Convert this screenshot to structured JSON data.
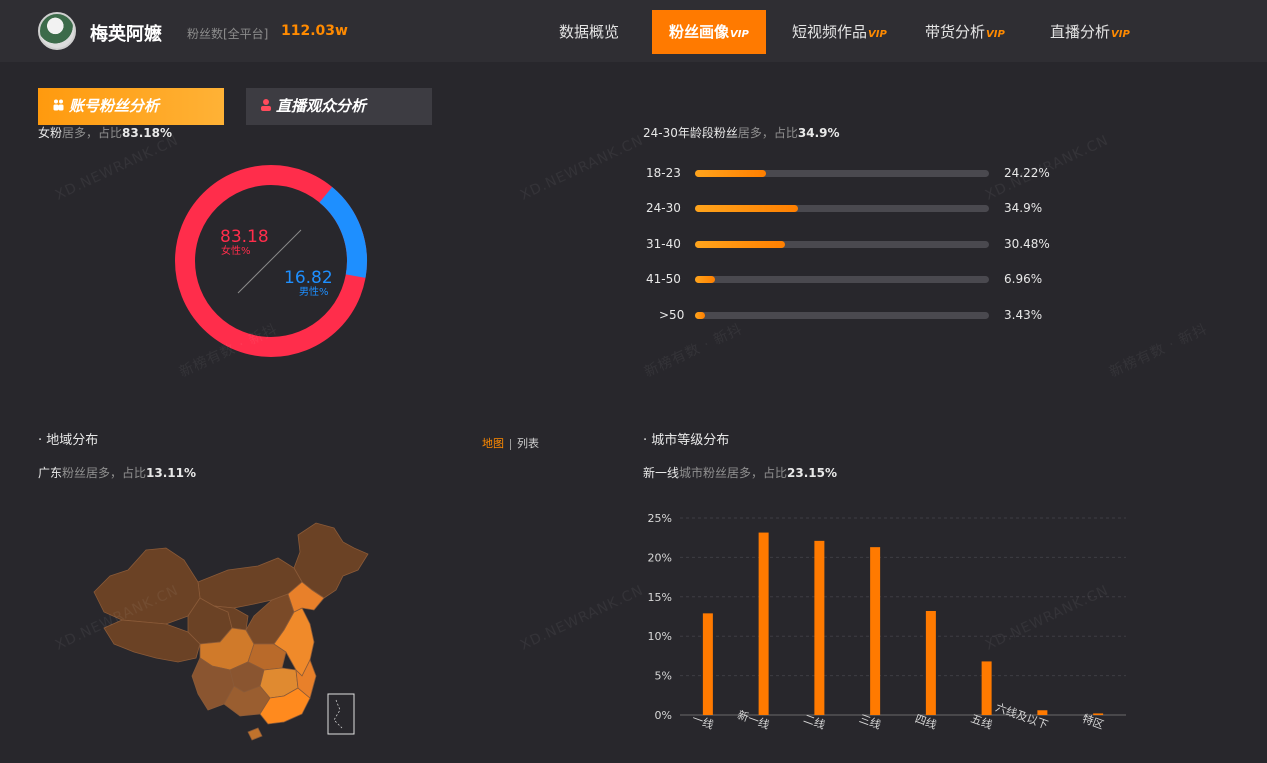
{
  "header": {
    "name": "梅英阿嬷",
    "fans_label": "粉丝数[全平台]",
    "fans_value": "112.03w",
    "nav": [
      {
        "label": "数据概览",
        "vip": ""
      },
      {
        "label": "粉丝画像",
        "vip": "VIP"
      },
      {
        "label": "短视频作品",
        "vip": "VIP"
      },
      {
        "label": "带货分析",
        "vip": "VIP"
      },
      {
        "label": "直播分析",
        "vip": "VIP"
      }
    ],
    "active_nav": "粉丝画像"
  },
  "subtabs": {
    "account_fans": "账号粉丝分析",
    "live_audience": "直播观众分析"
  },
  "gender": {
    "summary_lead": "女粉",
    "summary_mid": "居多，占比",
    "summary_value": "83.18%",
    "female_value": "83.18",
    "female_label": "女性%",
    "male_value": "16.82",
    "male_label": "男性%",
    "female_pct": 83.18,
    "male_pct": 16.82,
    "female_color": "#ff2d4b",
    "male_color": "#1e8fff"
  },
  "age": {
    "summary_lead": "24-30年龄段粉丝",
    "summary_mid": "居多，占比",
    "summary_value": "34.9%",
    "rows": [
      {
        "label": "18-23",
        "value": "24.22%",
        "pct": 24.22
      },
      {
        "label": "24-30",
        "value": "34.9%",
        "pct": 34.9
      },
      {
        "label": "31-40",
        "value": "30.48%",
        "pct": 30.48
      },
      {
        "label": "41-50",
        "value": "6.96%",
        "pct": 6.96
      },
      {
        "label": ">50",
        "value": "3.43%",
        "pct": 3.43
      }
    ],
    "bar_color": "#ff8a00"
  },
  "region": {
    "title": "地域分布",
    "map_label": "地图",
    "list_label": "列表",
    "summary_lead": "广东",
    "summary_mid": "粉丝居多，占比",
    "summary_value": "13.11%"
  },
  "city": {
    "title": "城市等级分布",
    "summary_lead": "新一线",
    "summary_mid": "城市粉丝居多，占比",
    "summary_value": "23.15%"
  },
  "watermarks": [
    "XD.NEWRANK.CN",
    "新榜有数 · 新抖"
  ],
  "chart_data": {
    "type": "bar",
    "categories": [
      "一线",
      "新一线",
      "二线",
      "三线",
      "四线",
      "五线",
      "六线及以下",
      "特区"
    ],
    "values": [
      12.9,
      23.15,
      22.1,
      21.3,
      13.2,
      6.8,
      0.6,
      0.2
    ],
    "ylim": [
      0,
      25
    ],
    "yticks": [
      "0%",
      "5%",
      "10%",
      "15%",
      "20%",
      "25%"
    ],
    "ytick_values": [
      0,
      5,
      10,
      15,
      20,
      25
    ],
    "grid": true,
    "bar_color": "#ff7a00"
  }
}
